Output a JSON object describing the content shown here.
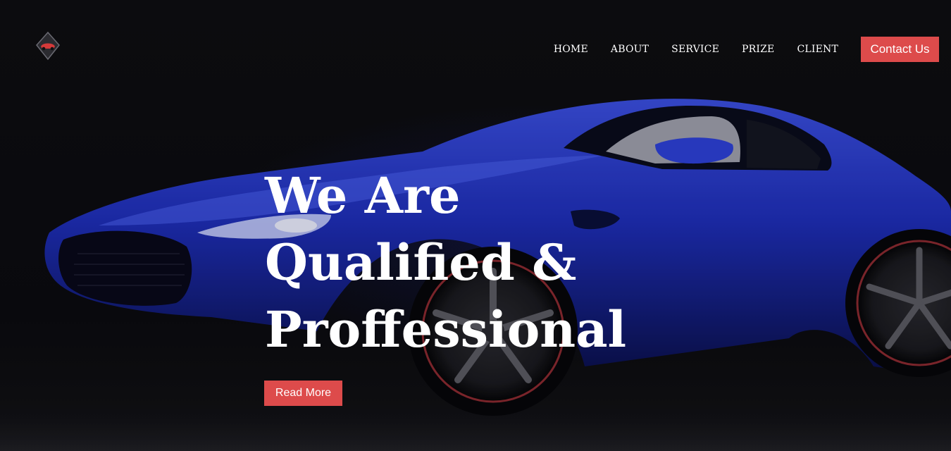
{
  "nav": {
    "items": [
      {
        "label": "HOME"
      },
      {
        "label": "ABOUT"
      },
      {
        "label": "SERVICE"
      },
      {
        "label": "PRIZE"
      },
      {
        "label": "CLIENT"
      }
    ],
    "contact_label": "Contact Us"
  },
  "hero": {
    "headline_lines": [
      "We Are",
      "Qualified &",
      "Proffessional"
    ],
    "cta_label": "Read More",
    "image": "blue-sports-car"
  },
  "logo": {
    "icon": "car-logo-icon"
  },
  "colors": {
    "accent": "#dd4b4b",
    "background": "#0c0c10",
    "car_blue": "#1f2fb8",
    "text": "#ffffff"
  }
}
